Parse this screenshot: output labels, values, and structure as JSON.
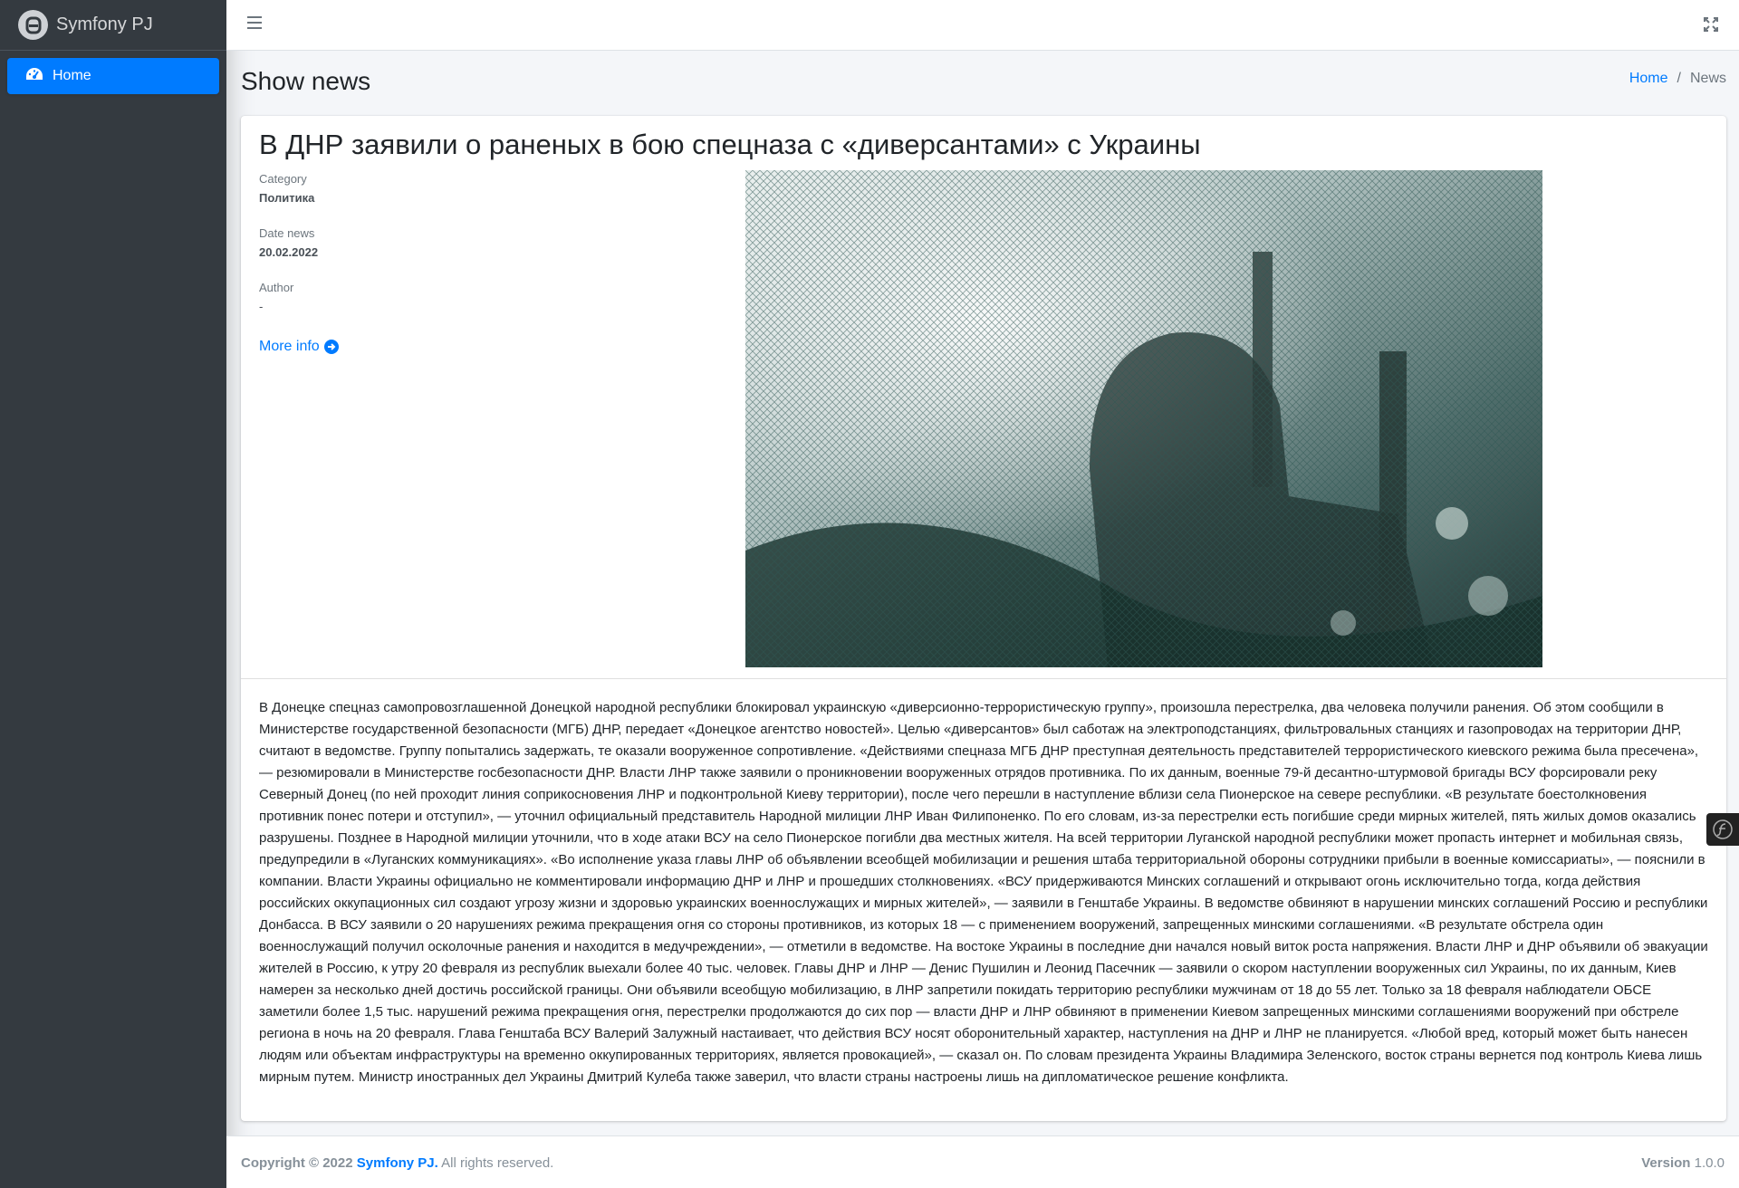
{
  "sidebar": {
    "brand": "Symfony PJ",
    "items": [
      {
        "label": "Home",
        "icon": "tachometer-icon"
      }
    ]
  },
  "header": {
    "page_title": "Show news",
    "breadcrumb": {
      "home": "Home",
      "current": "News"
    }
  },
  "news": {
    "title": "В ДНР заявили о раненых в бою спецназа с «диверсантами» с Украины",
    "category_label": "Category",
    "category_value": "Политика",
    "date_label": "Date news",
    "date_value": "20.02.2022",
    "author_label": "Author",
    "author_value": "-",
    "more_info": "More info",
    "body": "В Донецке спецназ самопровозглашенной Донецкой народной республики блокировал украинскую «диверсионно-террористическую группу», произошла перестрелка, два человека получили ранения. Об этом сообщили в Министерстве государственной безопасности (МГБ) ДНР, передает «Донецкое агентство новостей». Целью «диверсантов» был саботаж на электроподстанциях, фильтровальных станциях и газопроводах на территории ДНР, считают в ведомстве. Группу попытались задержать, те оказали вооруженное сопротивление. «Действиями спецназа МГБ ДНР преступная деятельность представителей террористического киевского режима была пресечена», — резюмировали в Министерстве госбезопасности ДНР. Власти ЛНР также заявили о проникновении вооруженных отрядов противника. По их данным, военные 79-й десантно-штурмовой бригады ВСУ форсировали реку Северный Донец (по ней проходит линия соприкосновения ЛНР и подконтрольной Киеву территории), после чего перешли в наступление вблизи села Пионерское на севере республики. «В результате боестолкновения противник понес потери и отступил», — уточнил официальный представитель Народной милиции ЛНР Иван Филипоненко. По его словам, из-за перестрелки есть погибшие среди мирных жителей, пять жилых домов оказались разрушены. Позднее в Народной милиции уточнили, что в ходе атаки ВСУ на село Пионерское погибли два местных жителя. На всей территории Луганской народной республики может пропасть интернет и мобильная связь, предупредили в «Луганских коммуникациях». «Во исполнение указа главы ЛНР об объявлении всеобщей мобилизации и решения штаба территориальной обороны сотрудники прибыли в военные комиссариаты», — пояснили в компании. Власти Украины официально не комментировали информацию ДНР и ЛНР и прошедших столкновениях. «ВСУ придерживаются Минских соглашений и открывают огонь исключительно тогда, когда действия российских оккупационных сил создают угрозу жизни и здоровью украинских военнослужащих и мирных жителей», — заявили в Генштабе Украины. В ведомстве обвиняют в нарушении минских соглашений Россию и республики Донбасса. В ВСУ заявили о 20 нарушениях режима прекращения огня со стороны противников, из которых 18 — с применением вооружений, запрещенных минскими соглашениями. «В результате обстрела один военнослужащий получил осколочные ранения и находится в медучреждении», — отметили в ведомстве. На востоке Украины в последние дни начался новый виток роста напряжения. Власти ЛНР и ДНР объявили об эвакуации жителей в Россию, к утру 20 февраля из республик выехали более 40 тыс. человек. Главы ДНР и ЛНР — Денис Пушилин и Леонид Пасечник — заявили о скором наступлении вооруженных сил Украины, по их данным, Киев намерен за несколько дней достичь российской границы. Они объявили всеобщую мобилизацию, в ЛНР запретили покидать территорию республики мужчинам от 18 до 55 лет. Только за 18 февраля наблюдатели ОБСЕ заметили более 1,5 тыс. нарушений режима прекращения огня, перестрелки продолжаются до сих пор — власти ДНР и ЛНР обвиняют в применении Киевом запрещенных минскими соглашениями вооружений при обстреле региона в ночь на 20 февраля. Глава Генштаба ВСУ Валерий Залужный настаивает, что действия ВСУ носят оборонительный характер, наступления на ДНР и ЛНР не планируется. «Любой вред, который может быть нанесен людям или объектам инфраструктуры на временно оккупированных территориях, является провокацией», — сказал он. По словам президента Украины Владимира Зеленского, восток страны вернется под контроль Киева лишь мирным путем. Министр иностранных дел Украины Дмитрий Кулеба также заверил, что власти страны настроены лишь на дипломатическое решение конфликта."
  },
  "footer": {
    "copyright_prefix": "Copyright © 2022",
    "brand_link": "Symfony PJ.",
    "rights": "All rights reserved.",
    "version_label": "Version",
    "version_value": "1.0.0"
  },
  "colors": {
    "primary": "#007bff",
    "sidebar_bg": "#343a40",
    "page_bg": "#f4f6f9"
  }
}
